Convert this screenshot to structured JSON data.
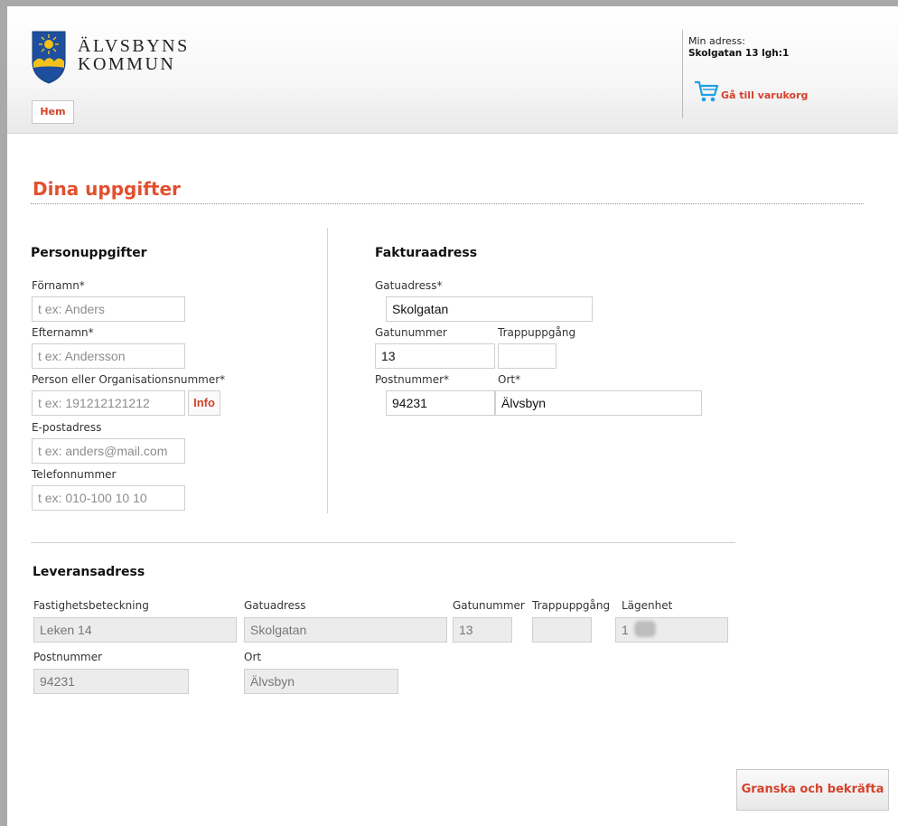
{
  "header": {
    "logo_line1": "ÄLVSBYNS",
    "logo_line2": "KOMMUN",
    "home_label": "Hem",
    "address_label": "Min adress:",
    "address_value": "Skolgatan 13 lgh:1",
    "cart_label": "Gå till varukorg"
  },
  "colors": {
    "accent": "#e2502e",
    "link": "#d6412b",
    "cart_icon": "#1ea0e6",
    "shield_blue": "#1e4f9e",
    "shield_gold": "#f2c21b"
  },
  "page_title": "Dina uppgifter",
  "personal": {
    "heading": "Personuppgifter",
    "first_name_label": "Förnamn*",
    "first_name_placeholder": "t ex: Anders",
    "last_name_label": "Efternamn*",
    "last_name_placeholder": "t ex: Andersson",
    "id_label": "Person eller Organisationsnummer*",
    "id_placeholder": "t ex: 191212121212",
    "info_label": "Info",
    "email_label": "E-postadress",
    "email_placeholder": "t ex: anders@mail.com",
    "phone_label": "Telefonnummer",
    "phone_placeholder": "t ex: 010-100 10 10"
  },
  "invoice": {
    "heading": "Fakturaadress",
    "street_label": "Gatuadress*",
    "street_value": "Skolgatan",
    "number_label": "Gatunummer",
    "number_value": "13",
    "entrance_label": "Trappuppgång",
    "entrance_value": "",
    "postal_label": "Postnummer*",
    "postal_value": "94231",
    "city_label": "Ort*",
    "city_value": "Älvsbyn"
  },
  "delivery": {
    "heading": "Leveransadress",
    "property_label": "Fastighetsbeteckning",
    "property_value": "Leken 14",
    "street_label": "Gatuadress",
    "street_value": "Skolgatan",
    "number_label": "Gatunummer",
    "number_value": "13",
    "entrance_label": "Trappuppgång",
    "entrance_value": "",
    "apartment_label": "Lägenhet",
    "apartment_value": "1",
    "postal_label": "Postnummer",
    "postal_value": "94231",
    "city_label": "Ort",
    "city_value": "Älvsbyn"
  },
  "submit_label": "Granska och bekräfta"
}
